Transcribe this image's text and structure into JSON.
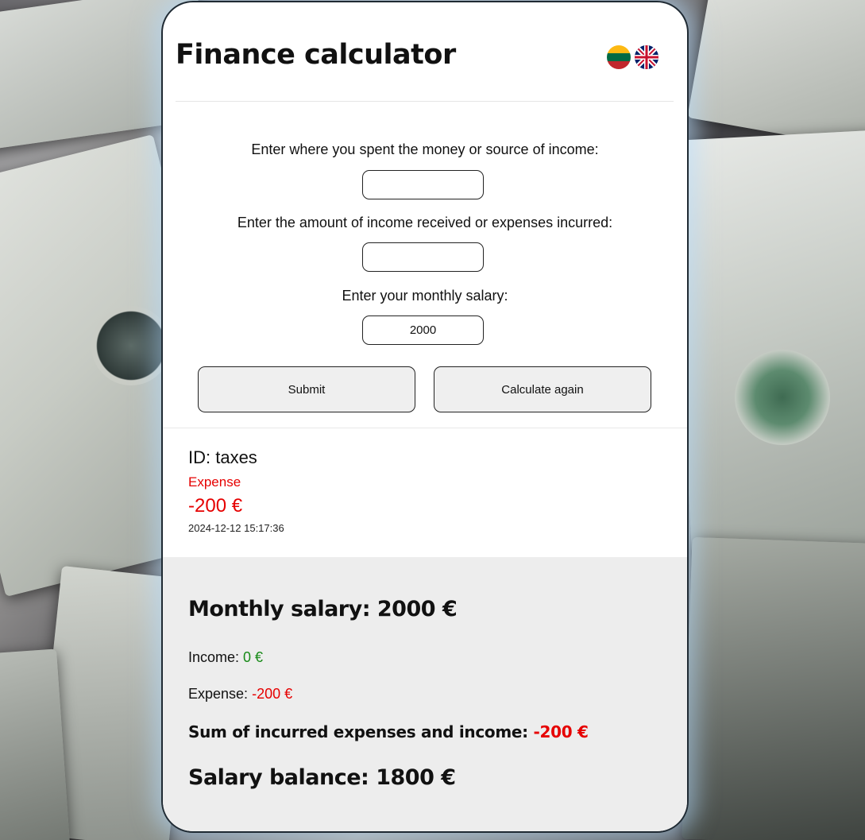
{
  "app": {
    "title": "Finance calculator"
  },
  "languages": [
    {
      "code": "lt",
      "icon": "lithuania-flag-icon"
    },
    {
      "code": "en",
      "icon": "uk-flag-icon"
    }
  ],
  "form": {
    "source_label": "Enter where you spent the money or source of income:",
    "source_value": "",
    "amount_label": "Enter the amount of income received or expenses incurred:",
    "amount_value": "",
    "salary_label": "Enter your monthly salary:",
    "salary_value": "2000",
    "submit_label": "Submit",
    "calculate_again_label": "Calculate again"
  },
  "entries": [
    {
      "id": "ID: taxes",
      "type": "Expense",
      "amount": "-200 €",
      "timestamp": "2024-12-12 15:17:36"
    }
  ],
  "summary": {
    "monthly_salary": "Monthly salary: 2000 €",
    "income_label": "Income:",
    "income_value": "0 €",
    "expense_label": "Expense:",
    "expense_value": "-200 €",
    "sum_label": "Sum of incurred expenses and income:",
    "sum_value": "-200 €",
    "salary_balance": "Salary balance: 1800 €"
  },
  "colors": {
    "income": "#178a17",
    "expense": "#e60000"
  }
}
